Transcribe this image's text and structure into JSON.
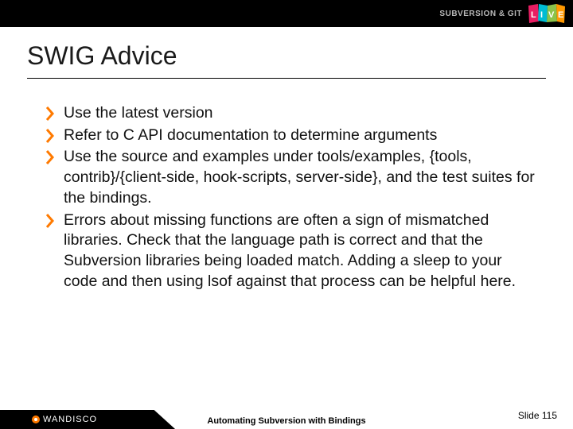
{
  "header": {
    "brand_text": "SUBVERSION & GIT",
    "live_word": "LIVE"
  },
  "title": "SWIG Advice",
  "bullets": [
    "Use the latest version",
    "Refer to C API documentation to determine arguments",
    "Use the source and examples under tools/examples, {tools, contrib}/{client-side, hook-scripts, server-side}, and the test suites for the bindings.",
    "Errors about missing functions are often a sign of mismatched libraries.  Check that the language path is correct and that the Subversion libraries being loaded match.  Adding a sleep to your code and then using lsof against that process can be helpful here."
  ],
  "footer": {
    "presentation_title": "Automating Subversion with Bindings",
    "slide_label": "Slide 115",
    "company": "WANDISCO"
  },
  "colors": {
    "accent": "#ff7a00"
  }
}
